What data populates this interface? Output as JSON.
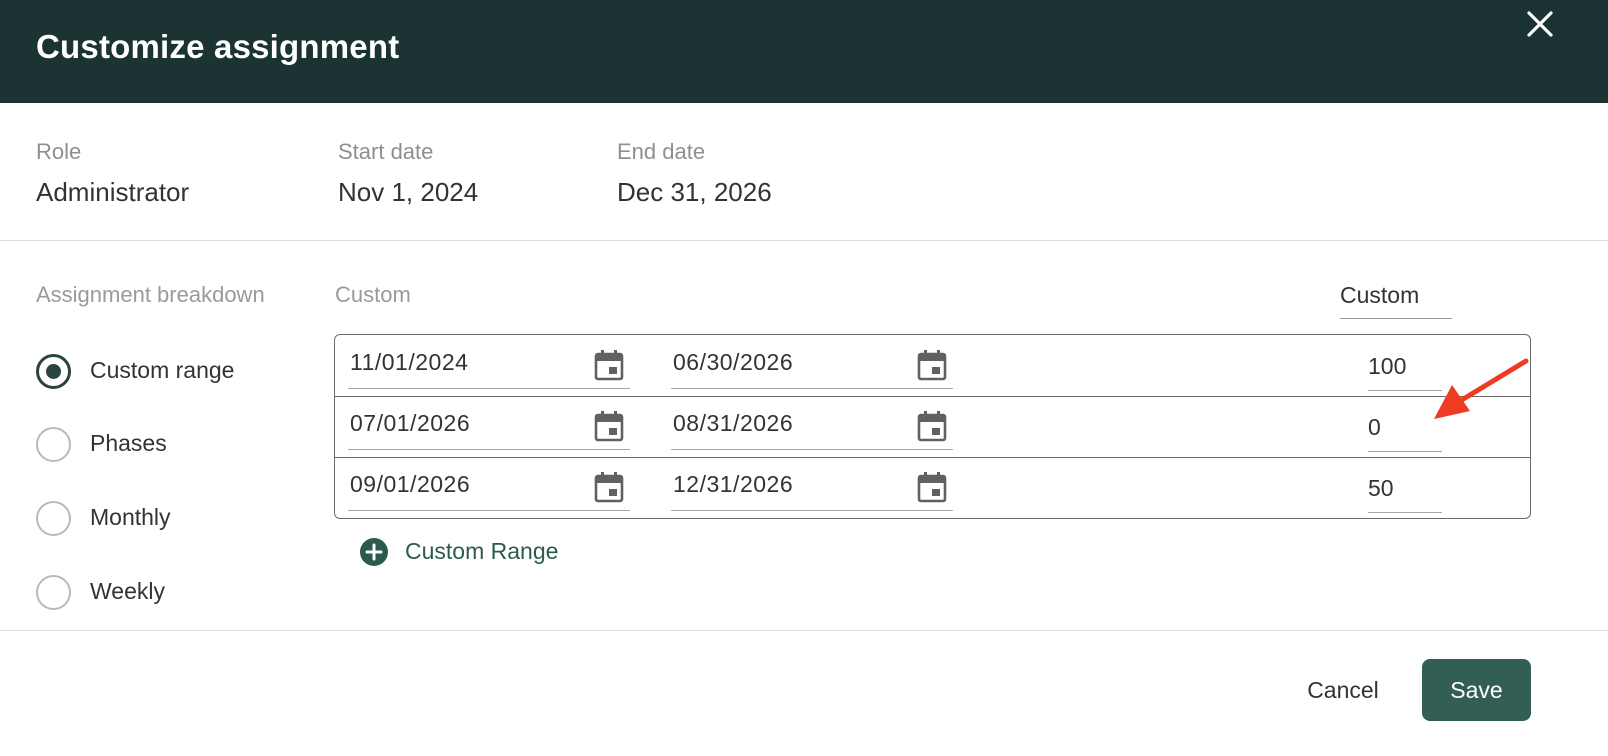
{
  "dialog": {
    "title": "Customize assignment",
    "close_icon": "close-icon"
  },
  "info": {
    "role_label": "Role",
    "role_value": "Administrator",
    "start_label": "Start date",
    "start_value": "Nov 1, 2024",
    "end_label": "End date",
    "end_value": "Dec 31, 2026"
  },
  "breakdown": {
    "label": "Assignment breakdown",
    "options": [
      {
        "label": "Custom range",
        "selected": true
      },
      {
        "label": "Phases",
        "selected": false
      },
      {
        "label": "Monthly",
        "selected": false
      },
      {
        "label": "Weekly",
        "selected": false
      }
    ]
  },
  "ranges": {
    "section_label": "Custom",
    "column_label": "Custom",
    "rows": [
      {
        "start": "11/01/2024",
        "end": "06/30/2026",
        "value": "100"
      },
      {
        "start": "07/01/2026",
        "end": "08/31/2026",
        "value": "0"
      },
      {
        "start": "09/01/2026",
        "end": "12/31/2026",
        "value": "50"
      }
    ],
    "add_label": "Custom Range"
  },
  "footer": {
    "cancel_label": "Cancel",
    "save_label": "Save"
  },
  "colors": {
    "header_bg": "#1b3332",
    "accent": "#335e55",
    "annotation_arrow": "#ee3b24"
  }
}
